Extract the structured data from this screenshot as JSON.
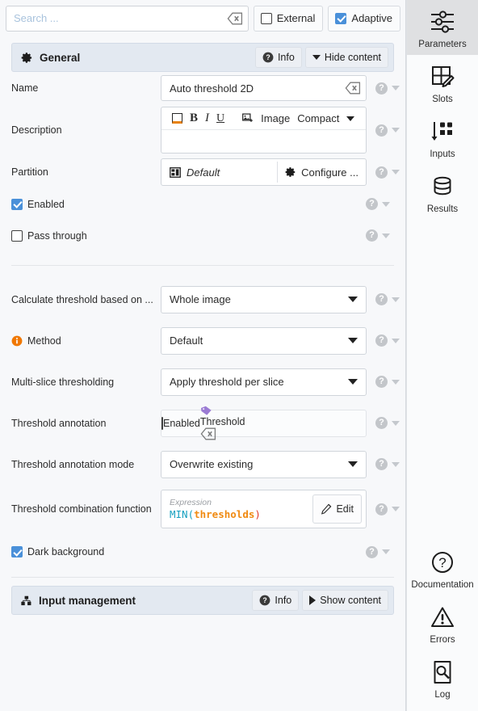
{
  "search": {
    "placeholder": "Search ...",
    "value": "",
    "clear_icon": "backspace-clear-icon"
  },
  "toolbar": {
    "external": {
      "label": "External",
      "checked": false
    },
    "adaptive": {
      "label": "Adaptive",
      "checked": true
    }
  },
  "sections": {
    "general": {
      "icon": "gear-icon",
      "title": "General",
      "info_label": "Info",
      "toggle_label": "Hide content",
      "expanded": true
    },
    "input_management": {
      "icon": "sitemap-icon",
      "title": "Input management",
      "info_label": "Info",
      "toggle_label": "Show content",
      "expanded": false
    }
  },
  "fields": {
    "name": {
      "label": "Name",
      "value": "Auto threshold 2D",
      "clear_icon": "backspace-clear-icon"
    },
    "description": {
      "label": "Description",
      "value": "",
      "toolbar": {
        "color_icon": "text-color-icon",
        "bold": "B",
        "italic": "I",
        "underline": "U",
        "image_icon": "insert-image-icon",
        "image_label": "Image",
        "mode_label": "Compact"
      }
    },
    "partition": {
      "label": "Partition",
      "icon": "partition-icon",
      "value": "Default",
      "configure_icon": "gear-icon",
      "configure_label": "Configure ..."
    },
    "enabled": {
      "label": "Enabled",
      "checked": true
    },
    "pass_through": {
      "label": "Pass through",
      "checked": false
    },
    "calculate_threshold": {
      "label": "Calculate threshold based on ...",
      "value": "Whole image"
    },
    "method": {
      "label": "Method",
      "status_icon": "info-orange-icon",
      "value": "Default"
    },
    "multi_slice": {
      "label": "Multi-slice thresholding",
      "value": "Apply threshold per slice"
    },
    "threshold_annotation": {
      "label": "Threshold annotation",
      "enabled_label": "Enabled",
      "enabled": false,
      "tag_icon": "tag-icon",
      "tag_value": "Threshold",
      "clear_icon": "backspace-clear-icon"
    },
    "threshold_annotation_mode": {
      "label": "Threshold annotation mode",
      "value": "Overwrite existing"
    },
    "threshold_combination": {
      "label": "Threshold combination function",
      "caption": "Expression",
      "expr_fn": "MIN(",
      "expr_arg": "thresholds",
      "expr_close": ")",
      "edit_icon": "pencil-icon",
      "edit_label": "Edit"
    },
    "dark_background": {
      "label": "Dark background",
      "checked": true
    }
  },
  "help_icon": "question-mark-icon",
  "rail": {
    "top_items": [
      {
        "icon": "sliders-icon",
        "label": "Parameters",
        "selected": true
      },
      {
        "icon": "slots-grid-icon",
        "label": "Slots",
        "selected": false
      },
      {
        "icon": "inputs-arrow-icon",
        "label": "Inputs",
        "selected": false
      },
      {
        "icon": "database-icon",
        "label": "Results",
        "selected": false
      }
    ],
    "bottom_items": [
      {
        "icon": "question-circle-icon",
        "label": "Documentation",
        "selected": false
      },
      {
        "icon": "warning-triangle-icon",
        "label": "Errors",
        "selected": false
      },
      {
        "icon": "log-search-icon",
        "label": "Log",
        "selected": false
      }
    ]
  },
  "colors": {
    "accent_blue": "#4a90d9",
    "section_header": "#e3e9f1",
    "orange": "#f07800",
    "tag_purple": "#9b7bd4",
    "expr_fn": "#16a0c0",
    "expr_arg": "#f08a11",
    "expr_paren": "#e0392b"
  }
}
